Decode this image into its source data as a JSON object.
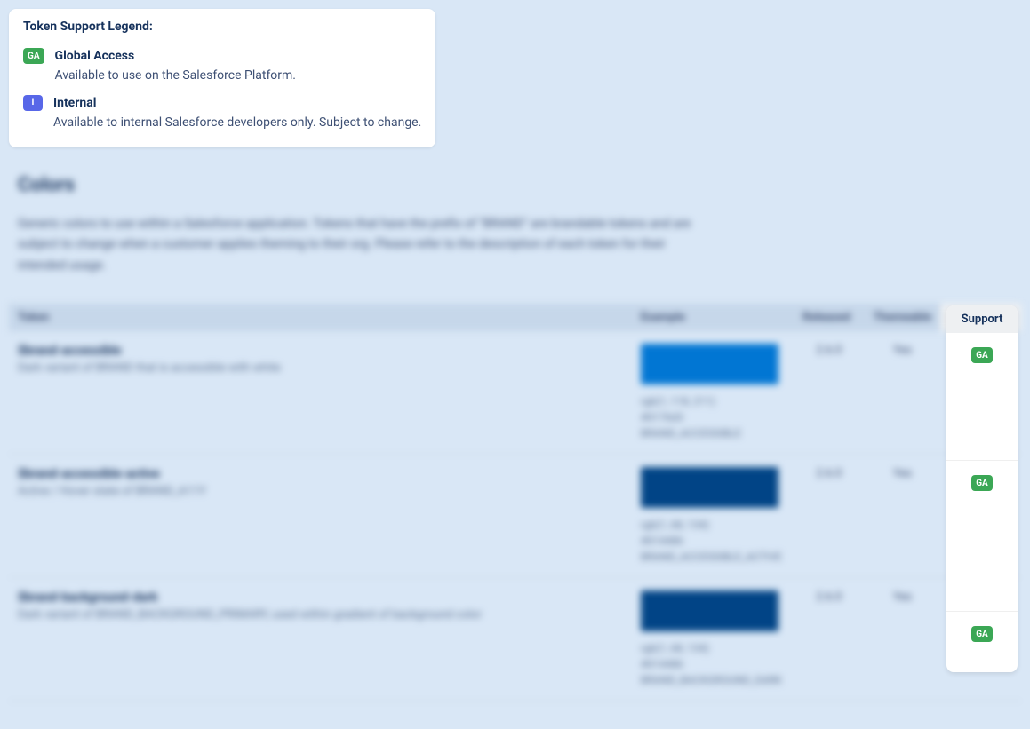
{
  "legend": {
    "title": "Token Support Legend:",
    "items": [
      {
        "badge": "GA",
        "badgeType": "ga",
        "name": "Global Access",
        "desc": "Available to use on the Salesforce Platform."
      },
      {
        "badge": "I",
        "badgeType": "i",
        "name": "Internal",
        "desc": "Available to internal Salesforce developers only. Subject to change."
      }
    ]
  },
  "section": {
    "heading": "Colors",
    "desc": "Generic colors to use within a Salesforce application. Tokens that have the prefix of \"BRAND\" are brandable tokens and are subject to change when a customer applies theming to their org. Please refer to the description of each token for their intended usage."
  },
  "tableHeaders": {
    "token": "Token",
    "example": "Example",
    "released": "Released",
    "themeable": "Themeable",
    "support": "Support"
  },
  "tokens": [
    {
      "name": "$brand-accessible",
      "desc": "Dark variant of BRAND that is accessible with white",
      "color": "#0176d3",
      "rgb": "rgb(1, 118, 211)",
      "hex": "#0176d3",
      "constant": "BRAND_ACCESSIBLE",
      "released": "2.6.0",
      "themeable": "Yes",
      "support": "GA"
    },
    {
      "name": "$brand-accessible-active",
      "desc": "Active / Hover state of BRAND_A11Y",
      "color": "#014486",
      "rgb": "rgb(1, 68, 134)",
      "hex": "#014486",
      "constant": "BRAND_ACCESSIBLE_ACTIVE",
      "released": "2.6.0",
      "themeable": "Yes",
      "support": "GA"
    },
    {
      "name": "$brand-background-dark",
      "desc": "Dark variant of BRAND_BACKGROUND_PRIMARY, used within gradient of background color",
      "color": "#014486",
      "rgb": "rgb(1, 68, 134)",
      "hex": "#014486",
      "constant": "BRAND_BACKGROUND_DARK",
      "released": "2.6.0",
      "themeable": "Yes",
      "support": "GA"
    }
  ]
}
